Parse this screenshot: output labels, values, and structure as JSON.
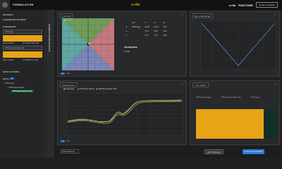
{
  "topbar": {
    "title": "FORMULATION",
    "brand": "x-rite",
    "brand_right": "x·rite",
    "pantone": "PANTONE",
    "button": "Create Feedback"
  },
  "sidebar": {
    "project": "PROJECT",
    "standard_filters": "STANDARD FILTERS",
    "standard": "STANDARD",
    "std_name": "PPOrange",
    "date_created_1": "Date Created",
    "date_val_1": "9/21/2023  10:45 AM",
    "sample": "PPOrange Sample Trial",
    "date_created_2": "Date Created",
    "date_val_2": "11/3/2023  1:21 PM",
    "data_filters": "DATA FILTERS",
    "data": "DATA",
    "tree_root": "PPOrange",
    "tree_child": "PPOrange Sample",
    "tree_sel": "PPOrange Sample Trial"
  },
  "strip": {
    "label": "FORMULATION DETAILS"
  },
  "panels": {
    "color_plot": {
      "title": "Color Plot",
      "ctrl": "⤢  ⋮"
    },
    "delta_table": {
      "headers": [
        "",
        "Lab",
        "L*",
        "a*",
        "b*"
      ],
      "rows": [
        [
          "▲",
          "PPOrange",
          "68.53",
          "44.71",
          "62.3"
        ],
        [
          "●",
          "",
          "0.70",
          "0.23",
          "0.62"
        ],
        [
          "●",
          "",
          "0.73",
          "0.27",
          "0.65"
        ]
      ],
      "tolerance_label": "TOLERANCE",
      "tolerance_value": "1.0 ΔE"
    },
    "error_plot": {
      "title": "ΔE vs Wavelength",
      "ctrl": "⤢  ⋮"
    },
    "spectral_curve": {
      "title": "Spectral Curve",
      "ctrl": "⤢  ⋮",
      "legend": [
        "PPOrange",
        "PPOrange Sample",
        "PPOrange Sample Trial"
      ],
      "y_ticks": [
        "100",
        "90",
        "80",
        "70",
        "60",
        "50",
        "40",
        "30",
        "20",
        "10",
        "0"
      ],
      "x_ticks": [
        "400",
        "440",
        "480",
        "520",
        "560",
        "600",
        "640",
        "680",
        "700"
      ]
    },
    "color_swatch": {
      "title": "Color Swatch",
      "ctrl": "⤢  ⋮",
      "labels": [
        "PPOrange Sample",
        "PPOrange Sample Trial",
        "PPOrange"
      ],
      "color": "#e8a317"
    }
  },
  "toggles": {
    "label": "Auto"
  },
  "bottombar": {
    "select": "Select Measure",
    "btn1": "Edit Trial Recipe",
    "btn2": "Proceed to Correction"
  },
  "colors": {
    "accent": "#e8a317",
    "blue": "#2e7bd6",
    "green": "#1a7f3d"
  }
}
